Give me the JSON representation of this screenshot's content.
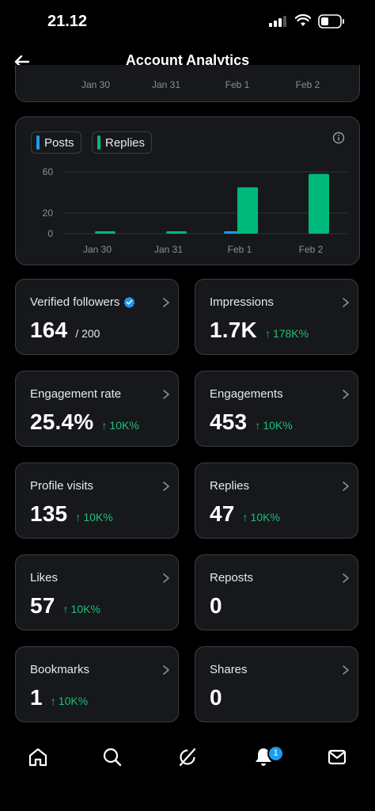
{
  "status": {
    "time": "21.12"
  },
  "header": {
    "title": "Account Analytics"
  },
  "top_chart": {
    "x_labels": [
      "Jan 30",
      "Jan 31",
      "Feb 1",
      "Feb 2"
    ]
  },
  "legend": {
    "posts_label": "Posts",
    "replies_label": "Replies",
    "posts_color": "#1d9bf0",
    "replies_color": "#00ba7c"
  },
  "chart_data": {
    "type": "bar",
    "categories": [
      "Jan 30",
      "Jan 31",
      "Feb 1",
      "Feb 2"
    ],
    "series": [
      {
        "name": "Posts",
        "values": [
          0,
          0,
          2,
          0
        ]
      },
      {
        "name": "Replies",
        "values": [
          2,
          1,
          45,
          58
        ]
      }
    ],
    "yticks": [
      0,
      20,
      60
    ],
    "ylim": [
      0,
      60
    ],
    "grid": true,
    "legend_position": "top-left"
  },
  "stats": [
    {
      "label": "Verified followers",
      "value": "164",
      "sub": "/ 200",
      "verified": true
    },
    {
      "label": "Impressions",
      "value": "1.7K",
      "change": "178K%"
    },
    {
      "label": "Engagement rate",
      "value": "25.4%",
      "change": "10K%"
    },
    {
      "label": "Engagements",
      "value": "453",
      "change": "10K%"
    },
    {
      "label": "Profile visits",
      "value": "135",
      "change": "10K%"
    },
    {
      "label": "Replies",
      "value": "47",
      "change": "10K%"
    },
    {
      "label": "Likes",
      "value": "57",
      "change": "10K%"
    },
    {
      "label": "Reposts",
      "value": "0"
    },
    {
      "label": "Bookmarks",
      "value": "1",
      "change": "10K%"
    },
    {
      "label": "Shares",
      "value": "0"
    }
  ],
  "change_arrow": "↑",
  "nav": {
    "items": [
      "home-icon",
      "search-icon",
      "grok-icon",
      "notifications-icon",
      "messages-icon"
    ],
    "notification_count": "1"
  }
}
